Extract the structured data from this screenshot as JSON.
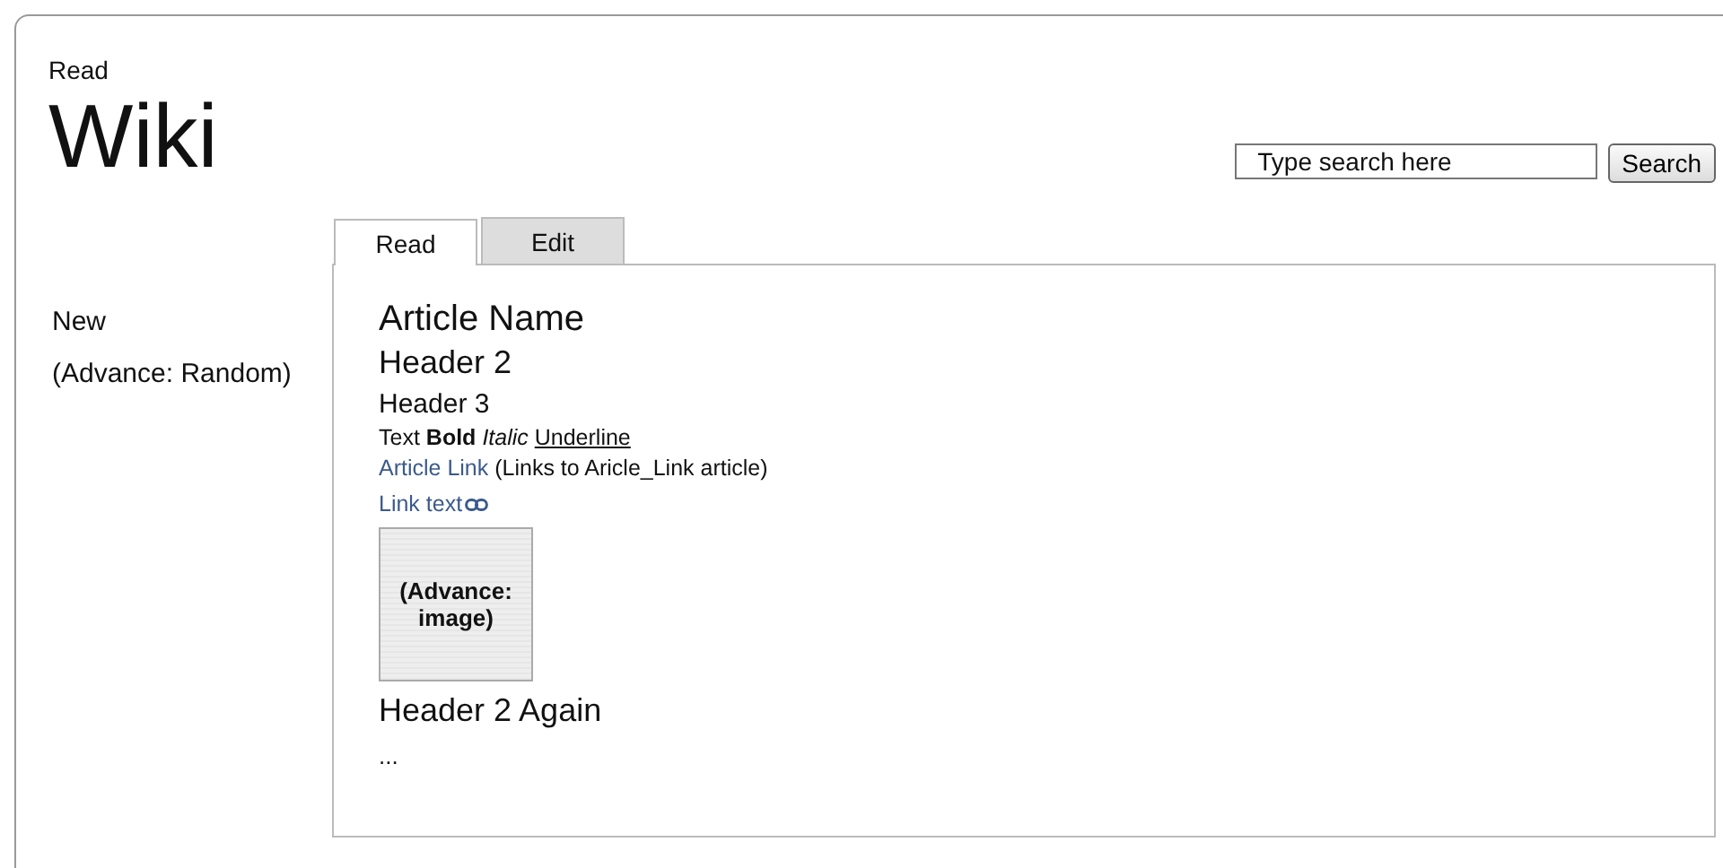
{
  "header": {
    "mode_label": "Read",
    "title": "Wiki"
  },
  "search": {
    "value": "Type search here",
    "button": "Search"
  },
  "sidebar": {
    "items": [
      "New",
      "(Advance: Random)"
    ]
  },
  "tabs": [
    {
      "label": "Read",
      "selected": true
    },
    {
      "label": "Edit",
      "selected": false
    }
  ],
  "article": {
    "title": "Article Name",
    "header2": "Header 2",
    "header3": "Header 3",
    "styled_text": [
      {
        "text": "Text",
        "kind": "plain"
      },
      {
        "text": "Bold",
        "kind": "bold"
      },
      {
        "text": "Italic",
        "kind": "italic"
      },
      {
        "text": "Underline",
        "kind": "underline"
      }
    ],
    "article_link": {
      "link": "Article Link",
      "note": "(Links to Aricle_Link article)"
    },
    "external_link": "Link text",
    "image_placeholder": "(Advance: image)",
    "header2_again": "Header 2 Again",
    "ellipsis": "..."
  }
}
